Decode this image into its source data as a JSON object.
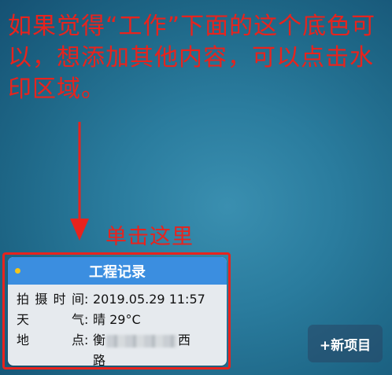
{
  "annotation": {
    "top_text": "如果觉得“工作”下面的这个底色可以，想添加其他内容，可以点击水印区域。",
    "click_here": "单击这里"
  },
  "watermark": {
    "title": "工程记录",
    "rows": [
      {
        "label_chars": [
          "拍",
          "摄",
          "时",
          "间"
        ],
        "colon": ":",
        "value": "2019.05.29 11:57"
      },
      {
        "label_chars": [
          "天",
          "气"
        ],
        "colon": ":",
        "value": "晴 29°C"
      },
      {
        "label_chars": [
          "地",
          "点"
        ],
        "colon": ":",
        "value_start": "衡",
        "value_end": "西",
        "value_line2": "路"
      }
    ]
  },
  "buttons": {
    "new_item": "+新项目"
  },
  "colors": {
    "annotation_red": "#e8231d",
    "header_blue": "#3b8ee0",
    "dot_yellow": "#f4c51a"
  }
}
